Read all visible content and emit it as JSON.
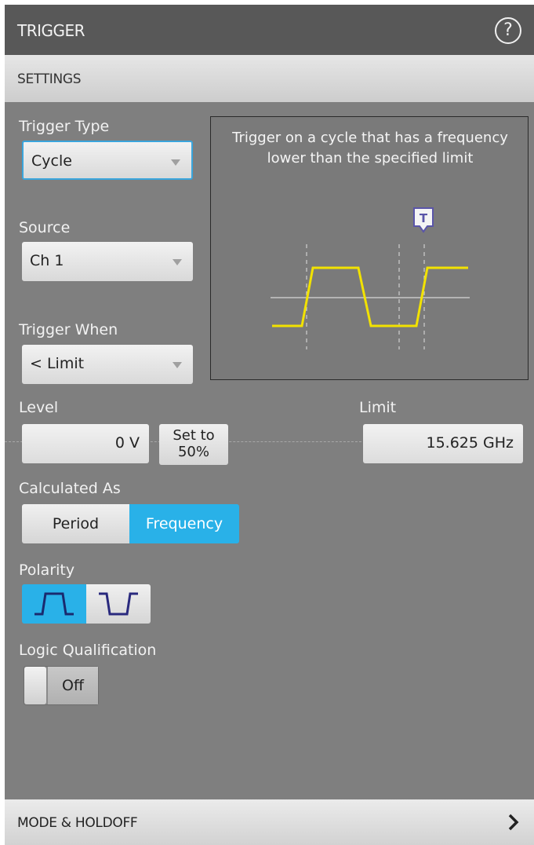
{
  "header": {
    "title": "TRIGGER",
    "help_icon": "?"
  },
  "settings": {
    "label": "SETTINGS"
  },
  "trigger_type": {
    "label": "Trigger Type",
    "value": "Cycle"
  },
  "source": {
    "label": "Source",
    "value": "Ch 1"
  },
  "trigger_when": {
    "label": "Trigger When",
    "value": "< Limit"
  },
  "description": {
    "text": "Trigger on a cycle that has a frequency lower than the specified limit",
    "marker": "T"
  },
  "level": {
    "label": "Level",
    "value": "0 V",
    "set50_line1": "Set to",
    "set50_line2": "50%"
  },
  "limit": {
    "label": "Limit",
    "value": "15.625 GHz"
  },
  "calculated_as": {
    "label": "Calculated As",
    "options": [
      "Period",
      "Frequency"
    ],
    "selected": "Frequency"
  },
  "polarity": {
    "label": "Polarity",
    "options": [
      "rising-edge-icon",
      "falling-edge-icon"
    ],
    "selected": "rising-edge-icon"
  },
  "logic_qualification": {
    "label": "Logic Qualification",
    "value": "Off"
  },
  "mode_holdoff": {
    "label": "MODE & HOLDOFF",
    "icon": "chevron-right-icon"
  },
  "colors": {
    "accent": "#29b1e8",
    "waveform": "#f2e200",
    "marker": "#5a55a8"
  }
}
